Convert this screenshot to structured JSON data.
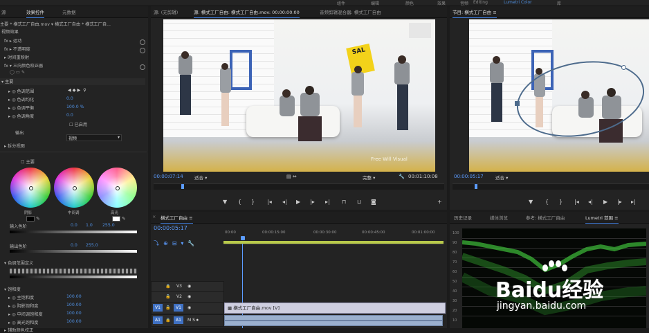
{
  "topbar": {
    "workspaces": [
      "组件",
      "编辑",
      "颜色",
      "效果",
      "音频",
      "Editing",
      "Lumetri Color",
      "库"
    ]
  },
  "left_panel": {
    "tabs": [
      "源",
      "效果控件",
      "元数据"
    ],
    "clip_path": "主要 * 横式工厂自由.mov ▾  横式工厂自由 * 横式工厂自...",
    "video_effects_label": "视频效果",
    "effects": [
      {
        "label": "运动"
      },
      {
        "label": "不透明度"
      },
      {
        "label": "时间重映射"
      },
      {
        "label": "三向颜色校正器"
      }
    ],
    "sub_label": "主要",
    "params": [
      {
        "label": "色调范围",
        "value": ""
      },
      {
        "label": "色调均化",
        "value": "0.0"
      },
      {
        "label": "色调平衡",
        "value": "100.0 %"
      },
      {
        "label": "色调角度",
        "value": "0.0"
      }
    ],
    "output_label": "输出",
    "output_value": "视频",
    "compare_label": "已启用",
    "split_view_label": "拆分视图",
    "wheels_label": "主要",
    "wheel_labels": [
      "阴影",
      "中间调",
      "高光"
    ],
    "input_levels_label": "输入色阶",
    "input_levels_values": [
      "0.0",
      "1.0",
      "255.0"
    ],
    "output_levels_label": "输出色阶",
    "output_levels_values": [
      "0.0",
      "255.0"
    ],
    "tonal_range_label": "色调范围定义",
    "saturation_label": "饱和度",
    "saturation_rows": [
      {
        "label": "主饱和度",
        "value": "100.00"
      },
      {
        "label": "阴影饱和度",
        "value": "100.00"
      },
      {
        "label": "中间调饱和度",
        "value": "100.00"
      },
      {
        "label": "高光饱和度",
        "value": "100.00"
      }
    ],
    "bottom_label": "辅助颜色校正"
  },
  "source_monitor": {
    "tabs": [
      "源: (无剪辑)",
      "源: 横式工厂自由: 横式工厂自由.mov: 00:00:00:00",
      "音频剪辑混合器: 横式工厂自由"
    ],
    "timecode_left": "00:00:07:14",
    "fit": "适合",
    "quality": "完整",
    "timecode_right": "00:01:10:08",
    "watermark": "Free Will Visual",
    "sign_text": "SAL"
  },
  "program_monitor": {
    "tab": "节目: 横式工厂自由 ≡",
    "timecode_left": "00:00:05:17",
    "fit": "适合"
  },
  "timeline": {
    "tab": "横式工厂自由 ≡",
    "timecode": "00:00:05:17",
    "ruler_labels": [
      "00:00",
      "00:00:15:00",
      "00:00:30:00",
      "00:00:45:00",
      "00:01:00:00"
    ],
    "video_tracks": [
      "V3",
      "V2",
      "V1"
    ],
    "audio_tracks": [
      "A1"
    ],
    "video_clip_label": "横式工厂自由.mov [V]",
    "src_patch": [
      "V1",
      "A1"
    ]
  },
  "scopes_panel": {
    "tabs": [
      "历史记录",
      "媒体浏览",
      "参考: 横式工厂自由",
      "Lumetri 范围 ≡"
    ],
    "scale": [
      "100",
      "90",
      "80",
      "70",
      "60",
      "50",
      "40",
      "30",
      "20",
      "10"
    ]
  },
  "watermark": {
    "brand": "Baidu经验",
    "url": "jingyan.baidu.com"
  },
  "colors": {
    "accent_blue": "#4f8fe0",
    "timecode_blue": "#5c9cff",
    "scope_green": "#3fbf3a",
    "panel_bg": "#232323"
  }
}
